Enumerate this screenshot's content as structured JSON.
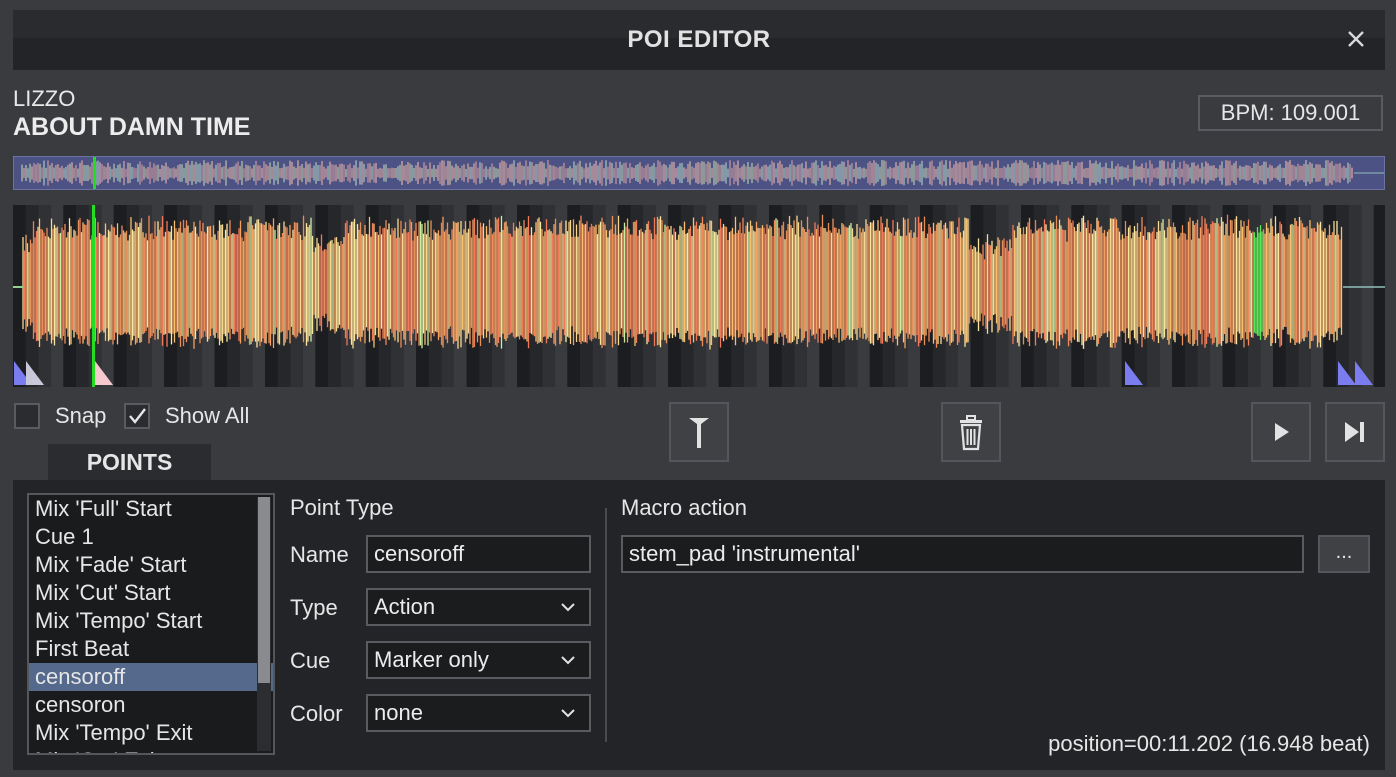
{
  "window": {
    "title": "POI EDITOR"
  },
  "track": {
    "artist": "LIZZO",
    "title": "ABOUT DAMN TIME",
    "bpm": "BPM: 109.001"
  },
  "colors": {
    "accent_selected": "#55698c",
    "playhead": "#22dd22",
    "overview_bg": "#4d5285",
    "marker_blue": "#7a7cf0"
  },
  "options": {
    "snap_label": "Snap",
    "snap_checked": false,
    "show_all_label": "Show All",
    "show_all_checked": true
  },
  "tabs": [
    {
      "label": "POINTS"
    }
  ],
  "points": [
    {
      "label": "Mix 'Full' Start"
    },
    {
      "label": "Cue 1"
    },
    {
      "label": "Mix 'Fade' Start"
    },
    {
      "label": "Mix 'Cut' Start"
    },
    {
      "label": "Mix 'Tempo' Start"
    },
    {
      "label": "First Beat"
    },
    {
      "label": "censoroff",
      "selected": true
    },
    {
      "label": "censoron"
    },
    {
      "label": "Mix 'Tempo' Exit"
    },
    {
      "label": "Mix 'Cut' Exit"
    }
  ],
  "editor": {
    "section_label": "Point Type",
    "name_label": "Name",
    "name_value": "censoroff",
    "type_label": "Type",
    "type_value": "Action",
    "cue_label": "Cue",
    "cue_value": "Marker only",
    "color_label": "Color",
    "color_value": "none",
    "macro_label": "Macro action",
    "macro_value": "stem_pad 'instrumental'",
    "browse_label": "..."
  },
  "status": {
    "position": "position=00:11.202 (16.948 beat)"
  },
  "icons": {
    "close": "close-icon",
    "marker": "marker-icon",
    "delete": "trash-icon",
    "play": "play-icon",
    "skip": "skip-next-icon",
    "checkmark": "checkmark-icon",
    "chevron": "chevron-down-icon"
  }
}
